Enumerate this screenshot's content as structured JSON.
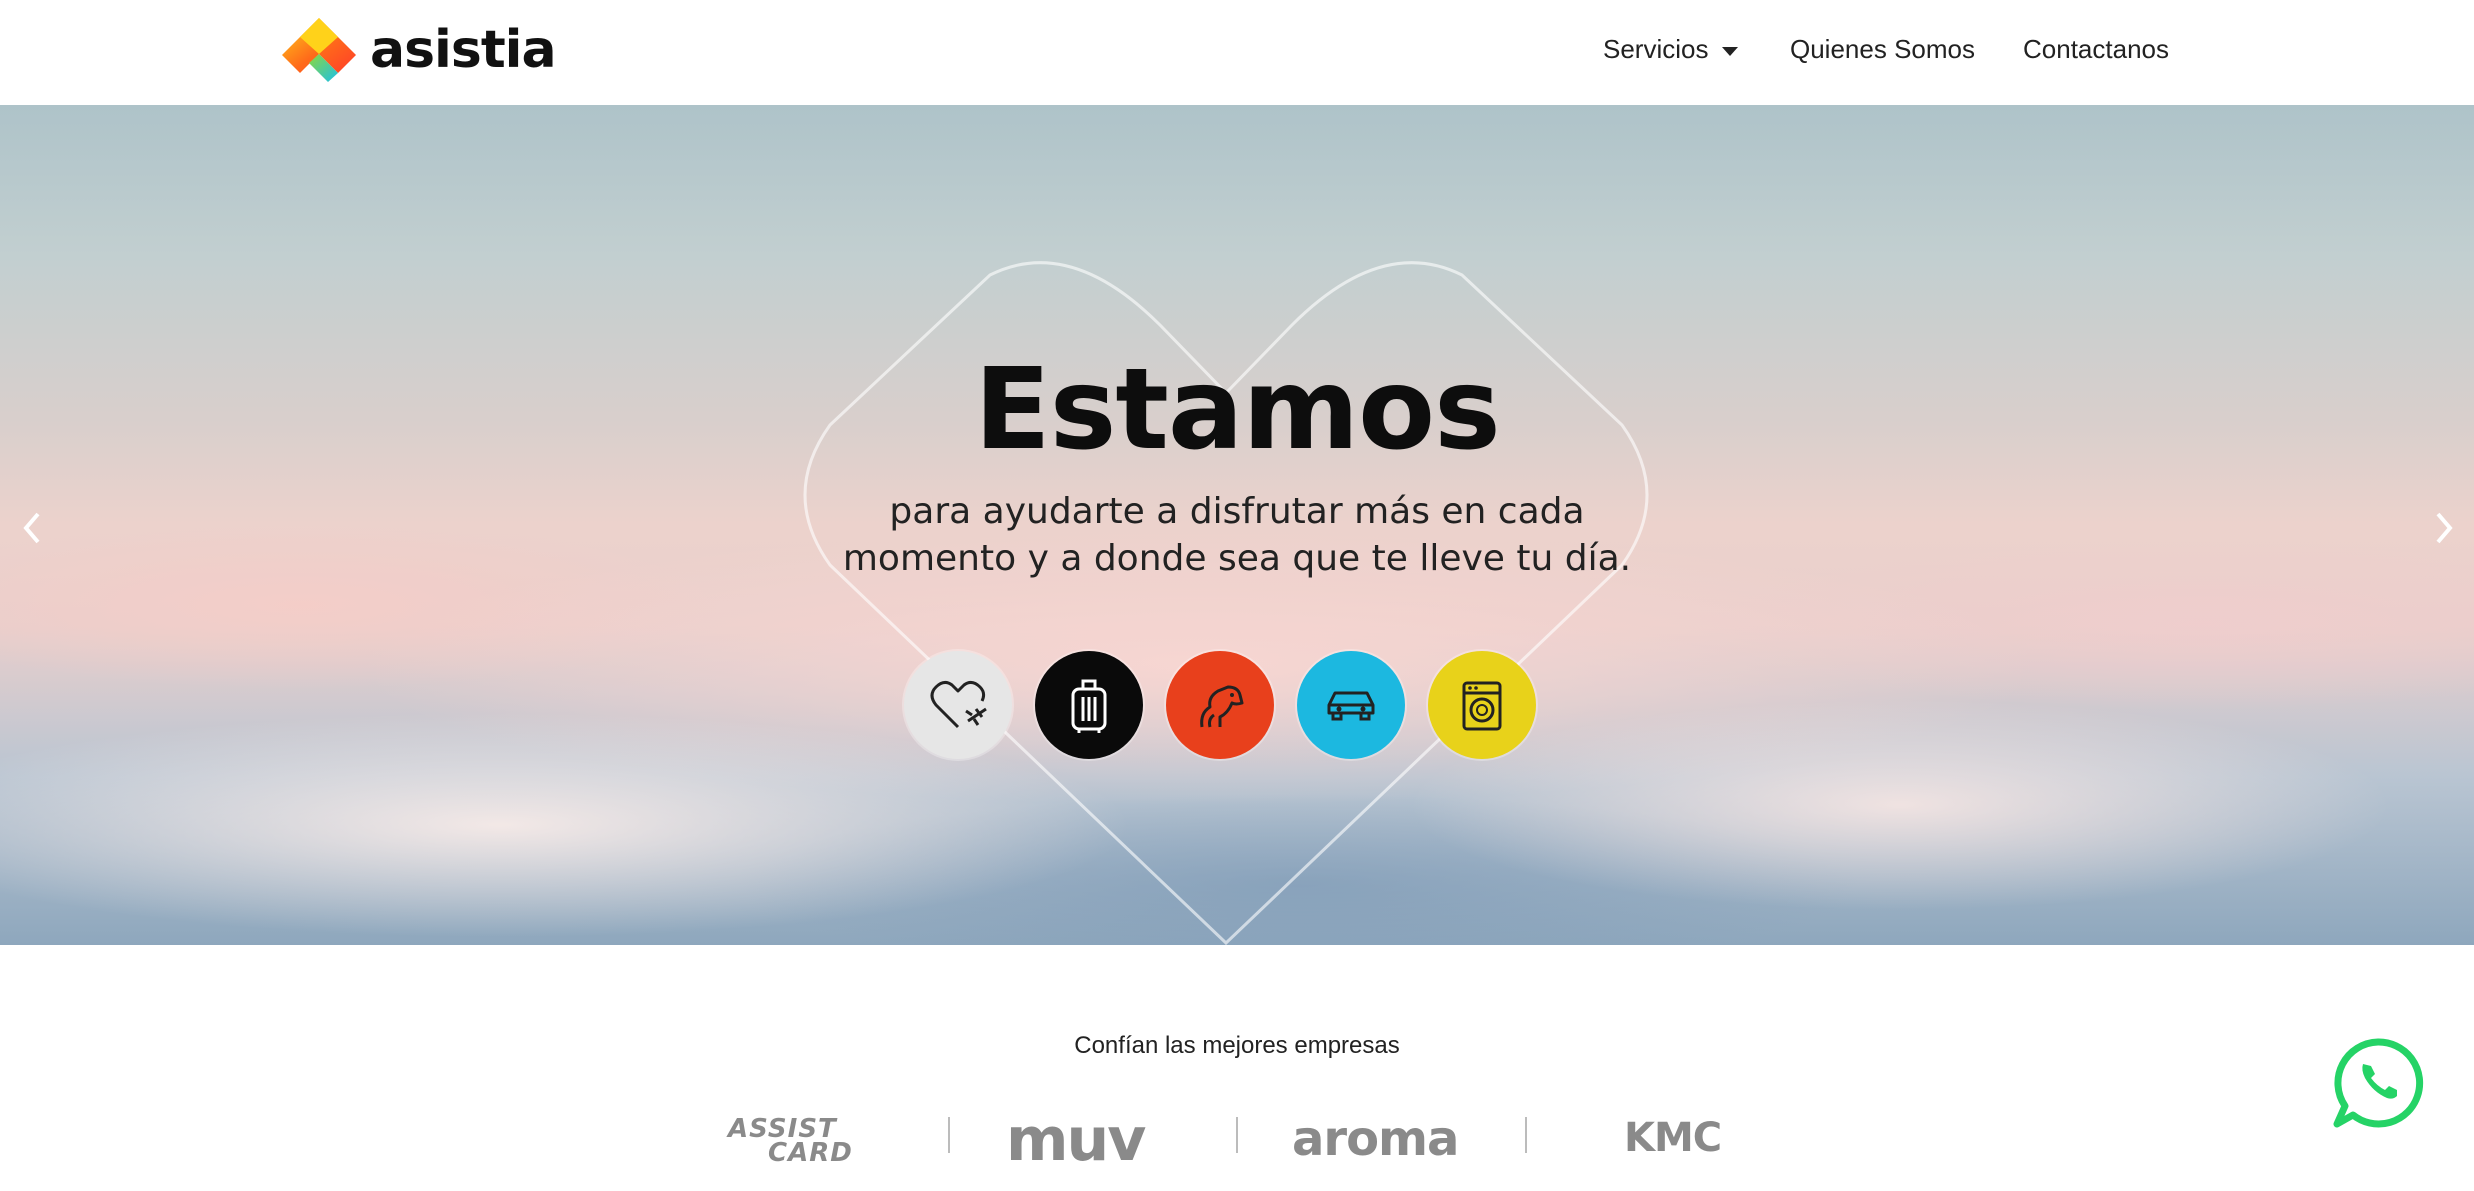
{
  "header": {
    "brand": "asistia",
    "nav": {
      "services": "Servicios",
      "about": "Quienes Somos",
      "contact": "Contactanos"
    }
  },
  "hero": {
    "title": "Estamos",
    "subtitle_line1": "para ayudarte a disfrutar más en cada",
    "subtitle_line2": "momento y a donde sea que te lleve tu día.",
    "service_icons": [
      {
        "name": "heart-plane-icon",
        "bg": "#e6e6e6"
      },
      {
        "name": "luggage-icon",
        "bg": "#0a0a0a"
      },
      {
        "name": "pets-icon",
        "bg": "#e8401c"
      },
      {
        "name": "car-icon",
        "bg": "#1cb8e0"
      },
      {
        "name": "washing-machine-icon",
        "bg": "#e8d21a"
      }
    ]
  },
  "partners": {
    "title": "Confían las mejores empresas",
    "logos": {
      "assist_line1": "ASSIST",
      "assist_line2": "CARD",
      "muv": "muv",
      "aroma": "aroma",
      "kmc": "KMC"
    }
  },
  "colors": {
    "whatsapp": "#25d366",
    "logo_gradient": [
      "#ffd21a",
      "#ff6a1a",
      "#1cc0e8"
    ]
  }
}
